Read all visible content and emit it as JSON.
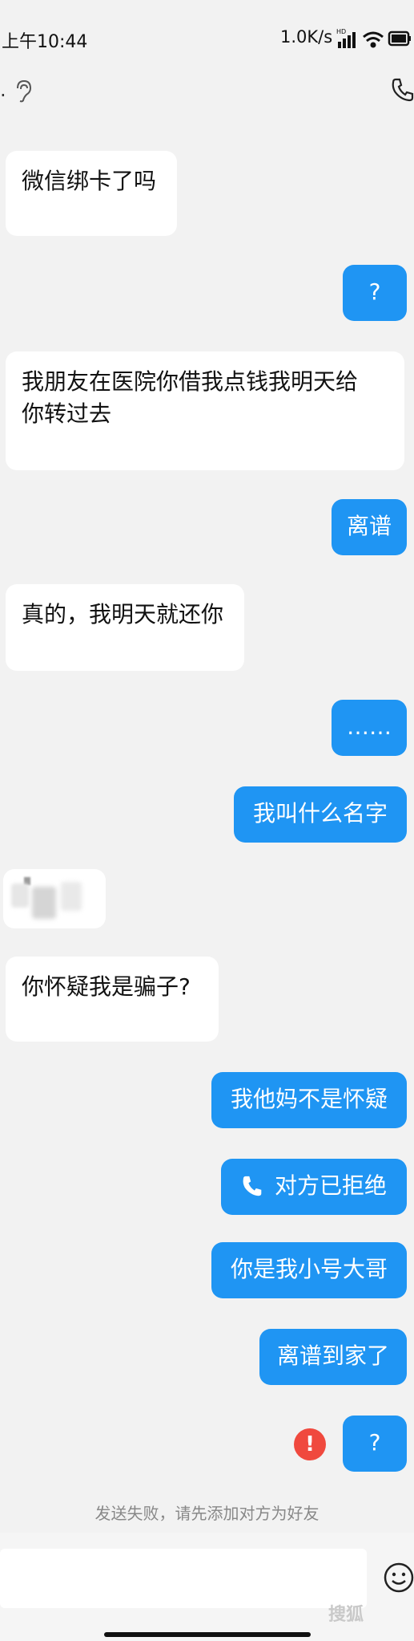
{
  "status_bar": {
    "time": "上午10:44",
    "network_speed": "1.0K/s",
    "icons": [
      "hd-signal-icon",
      "wifi-icon",
      "battery-icon"
    ]
  },
  "header": {
    "left_text": ".",
    "icons": [
      "ear-icon",
      "phone-icon"
    ]
  },
  "messages": {
    "m1": "微信绑卡了吗",
    "m2": "?",
    "m3a": "我朋友在医院你借我点钱我明天给",
    "m3b": "你转过去",
    "m4": "离谱",
    "m5": "真的，我明天就还你",
    "m6": "……",
    "m7": "我叫什么名字",
    "m9": "你怀疑我是骗子?",
    "m10": "我他妈不是怀疑",
    "m11": "对方已拒绝",
    "m12": "你是我小号大哥",
    "m13": "离谱到家了",
    "m14": "?"
  },
  "error_mark": "!",
  "footer_note": "发送失败，请先添加对方为好友",
  "watermark": "搜狐",
  "colors": {
    "sent_bubble": "#1f95f3",
    "received_bubble": "#ffffff",
    "background": "#f2f2f2",
    "error": "#f0493e"
  }
}
